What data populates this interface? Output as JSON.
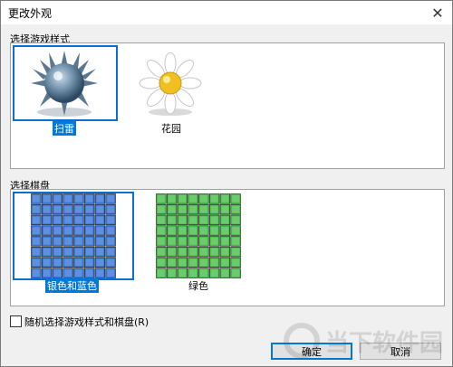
{
  "window": {
    "title": "更改外观",
    "close_glyph": "✕"
  },
  "styles_section": {
    "label": "选择游戏样式",
    "items": [
      {
        "caption": "扫雷",
        "selected": true,
        "icon": "mine-icon"
      },
      {
        "caption": "花园",
        "selected": false,
        "icon": "flower-icon"
      }
    ]
  },
  "boards_section": {
    "label": "选择棋盘",
    "items": [
      {
        "caption": "银色和蓝色",
        "selected": true,
        "color": "#3a78d8"
      },
      {
        "caption": "绿色",
        "selected": false,
        "color": "#4cc04c"
      }
    ]
  },
  "random_option": {
    "label": "随机选择游戏样式和棋盘(R)",
    "checked": false
  },
  "buttons": {
    "ok": "确定",
    "cancel": "取消"
  },
  "watermark": {
    "text": "当下软件园"
  }
}
